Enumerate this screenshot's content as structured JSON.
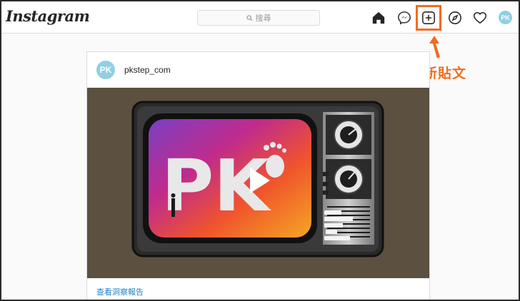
{
  "app": {
    "logo_text": "Instagram"
  },
  "search": {
    "placeholder": "搜尋"
  },
  "nav": {
    "icons": [
      "home-icon",
      "messenger-icon",
      "new-post-icon",
      "explore-icon",
      "heart-icon",
      "profile-avatar"
    ],
    "avatar_initials": "PK"
  },
  "annotation": {
    "callout_text": "上傳新貼文",
    "highlight_color": "#f26b21"
  },
  "post": {
    "username": "pkstep_com",
    "avatar_initials": "PK",
    "media_logo_text": "PK",
    "insights_link": "查看洞察報告"
  },
  "colors": {
    "accent": "#f26b21",
    "link": "#1e83c9",
    "avatar": "#8fd0e2"
  }
}
